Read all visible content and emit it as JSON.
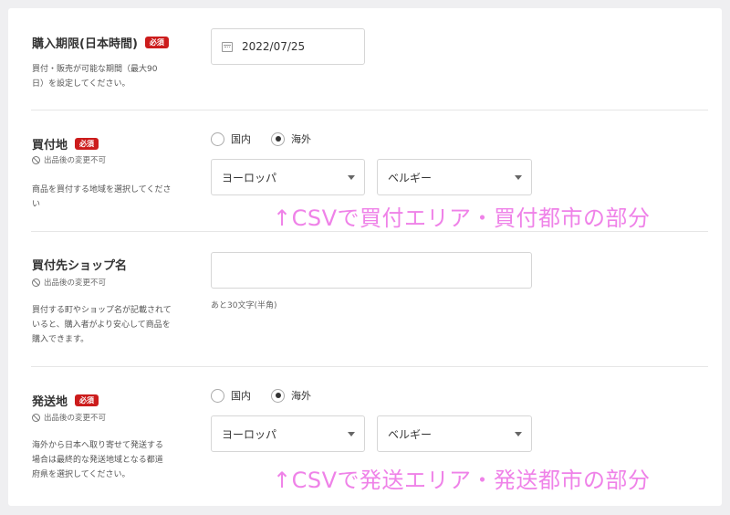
{
  "purchase_period": {
    "label": "購入期限(日本時間)",
    "required_badge": "必須",
    "desc_line1": "買付・販売が可能な期間（最大90",
    "desc_line2": "日）を設定してください。",
    "date_value": "2022/07/25",
    "date_icon": "calendar-icon"
  },
  "buying_location": {
    "label": "買付地",
    "required_badge": "必須",
    "note": "出品後の変更不可",
    "desc_line1": "商品を買付する地域を選択してくださ",
    "desc_line2": "い",
    "radio_domestic": "国内",
    "radio_overseas": "海外",
    "selected": "海外",
    "region_value": "ヨーロッパ",
    "country_value": "ベルギー",
    "annotation": "↑CSVで買付エリア・買付都市の部分"
  },
  "shop_name": {
    "label": "買付先ショップ名",
    "note": "出品後の変更不可",
    "desc_line1": "買付する町やショップ名が記載されて",
    "desc_line2": "いると、購入者がより安心して商品を",
    "desc_line3": "購入できます。",
    "input_value": "",
    "hint": "あと30文字(半角)"
  },
  "shipping_location": {
    "label": "発送地",
    "required_badge": "必須",
    "note": "出品後の変更不可",
    "desc_line1": "海外から日本へ取り寄せて発送する",
    "desc_line2": "場合は最終的な発送地域となる都道",
    "desc_line3": "府県を選択してください。",
    "radio_domestic": "国内",
    "radio_overseas": "海外",
    "selected": "海外",
    "region_value": "ヨーロッパ",
    "country_value": "ベルギー",
    "annotation": "↑CSVで発送エリア・発送都市の部分"
  },
  "colors": {
    "badge": "#cc1c1c",
    "annotation": "#ef82e8",
    "background": "#efeff1"
  }
}
